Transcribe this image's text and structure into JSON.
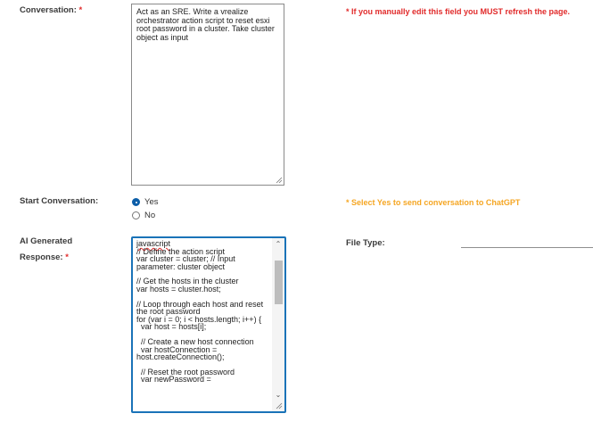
{
  "conversation": {
    "label": "Conversation:",
    "required_mark": "*",
    "value": "Act as an SRE. Write a vrealize orchestrator action script to reset esxi root password in a cluster. Take cluster object as input",
    "note": "* If you manually edit this field you MUST refresh the page."
  },
  "start_conversation": {
    "label": "Start Conversation:",
    "options": [
      {
        "label": "Yes",
        "selected": true
      },
      {
        "label": "No",
        "selected": false
      }
    ],
    "note": "* Select Yes to send conversation to ChatGPT"
  },
  "ai_response": {
    "label_line1": "AI Generated",
    "label_line2": "Response:",
    "required_mark": "*",
    "lines": [
      "javascript",
      "// Define the action script",
      "var cluster = cluster; // Input parameter: cluster object",
      "// Get the hosts in the cluster",
      "var hosts = cluster.host;",
      "// Loop through each host and reset the root password",
      "for (var i = 0; i < hosts.length; i++) {",
      "  var host = hosts[i];",
      "  // Create a new host connection",
      "  var hostConnection =",
      "host.createConnection();",
      "  // Reset the root password",
      "  var newPassword ="
    ]
  },
  "file_type": {
    "label": "File Type:",
    "value": ""
  },
  "colors": {
    "required": "#e12b2b",
    "warning": "#f5a623",
    "accent": "#1a73b8"
  }
}
